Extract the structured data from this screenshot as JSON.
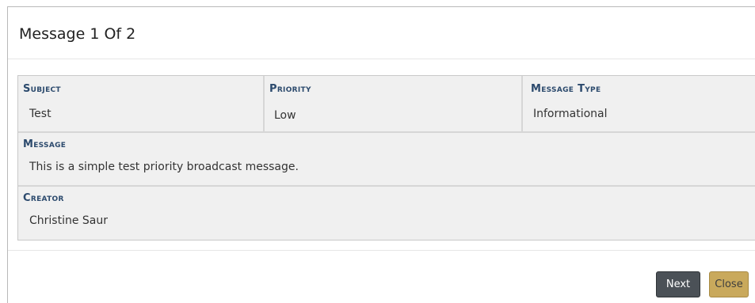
{
  "dialog": {
    "title": "Message 1 Of 2"
  },
  "fields": {
    "subject": {
      "label": "Subject",
      "value": "Test"
    },
    "priority": {
      "label": "Priority",
      "value": "Low"
    },
    "message_type": {
      "label": "Message Type",
      "value": "Informational"
    },
    "message": {
      "label": "Message",
      "value": "This is a simple test priority broadcast message."
    },
    "creator": {
      "label": "Creator",
      "value": "Christine Saur"
    }
  },
  "buttons": {
    "next_label": "Next",
    "close_label": "Close"
  },
  "colors": {
    "label_color": "#2c4a6d",
    "next_button_bg": "#4b5157",
    "close_button_bg": "#c9a95c",
    "details_bg": "#f0f0f0"
  }
}
